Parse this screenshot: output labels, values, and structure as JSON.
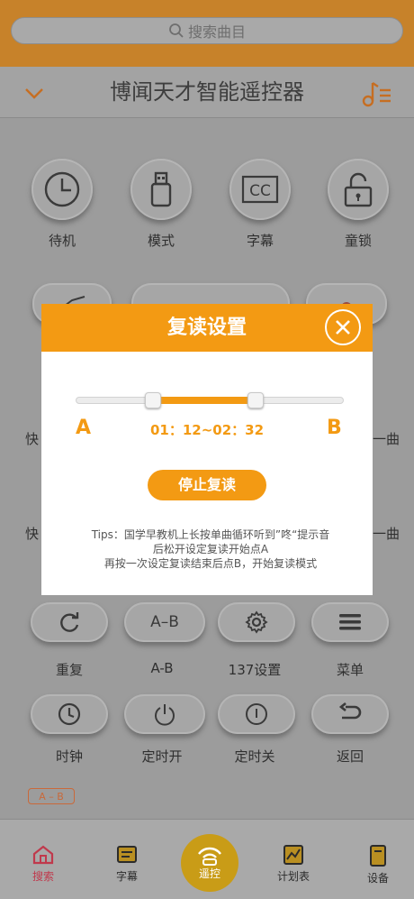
{
  "search": {
    "placeholder": "搜索曲目"
  },
  "header": {
    "title": "博闻天才智能遥控器"
  },
  "row1": [
    {
      "label": "待机",
      "icon": "clock-icon"
    },
    {
      "label": "模式",
      "icon": "usb-drive-icon"
    },
    {
      "label": "字幕",
      "icon": "cc-icon"
    },
    {
      "label": "童锁",
      "icon": "unlock-icon"
    }
  ],
  "side_labels": {
    "left1": "快",
    "right1": "一曲",
    "left2": "快",
    "right2": "一曲"
  },
  "row_pills": [
    {
      "label": "重复",
      "icon": "repeat-icon"
    },
    {
      "label": "A-B",
      "text": "A–B"
    },
    {
      "label": "137设置",
      "icon": "gear-icon"
    },
    {
      "label": "菜单",
      "icon": "menu-icon"
    }
  ],
  "row_pills2": [
    {
      "label": "时钟",
      "icon": "clock-icon"
    },
    {
      "label": "定时开",
      "icon": "power-icon"
    },
    {
      "label": "定时关",
      "icon": "power-off-icon"
    },
    {
      "label": "返回",
      "icon": "back-icon"
    }
  ],
  "badge": "A – B",
  "modal": {
    "title": "复读设置",
    "a_label": "A",
    "b_label": "B",
    "range_text": "01：12~02：32",
    "stop_button": "停止复读",
    "tips_line1": "Tips：国学早教机上长按单曲循环听到”咚“提示音",
    "tips_line2": "后松开设定复读开始点A",
    "tips_line3": "再按一次设定复读结束后点B，开始复读模式",
    "slider": {
      "start_fraction": 0.29,
      "end_fraction": 0.67
    }
  },
  "tabs": [
    {
      "label": "搜索",
      "color": "#c0394c"
    },
    {
      "label": "字幕"
    },
    {
      "label": "遥控"
    },
    {
      "label": "计划表"
    },
    {
      "label": "设备"
    }
  ],
  "colors": {
    "accent": "#f39a13",
    "dim_overlay": "#9c9c9c"
  }
}
